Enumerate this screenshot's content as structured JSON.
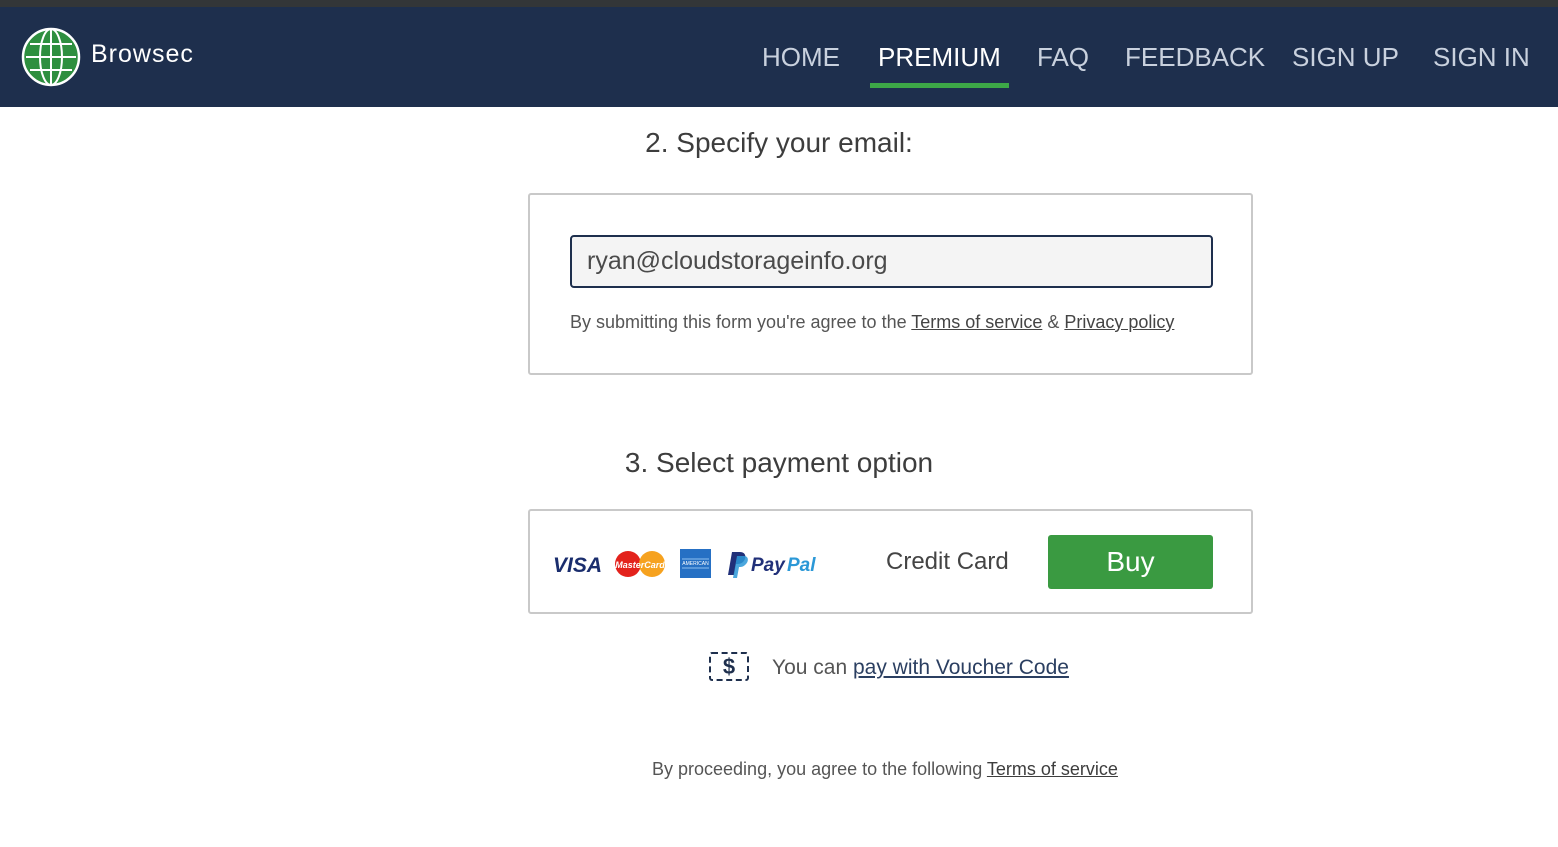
{
  "brand": {
    "name": "Browsec"
  },
  "nav": {
    "items": [
      {
        "label": "HOME"
      },
      {
        "label": "PREMIUM",
        "active": true
      },
      {
        "label": "FAQ"
      },
      {
        "label": "FEEDBACK"
      },
      {
        "label": "SIGN UP"
      },
      {
        "label": "SIGN IN"
      }
    ]
  },
  "email_section": {
    "heading": "2. Specify your email:",
    "email_value": "ryan@cloudstorageinfo.org",
    "agree_text": "By submitting this form you're agree to the",
    "terms_label": "Terms of service",
    "amp": "&",
    "privacy_label": "Privacy policy"
  },
  "payment_section": {
    "heading": "3. Select payment option",
    "card_logos": [
      "visa-logo",
      "mastercard-logo",
      "amex-logo",
      "paypal-logo"
    ],
    "method_label": "Credit Card",
    "buy_label": "Buy"
  },
  "voucher": {
    "icon": "dollar-voucher-icon",
    "icon_glyph": "$",
    "prefix": "You can",
    "link_label": "pay with Voucher Code"
  },
  "footer_agree": {
    "text": "By proceeding, you agree to the following",
    "terms_label": "Terms of service"
  },
  "colors": {
    "navbar_bg": "#1e2f4d",
    "accent_green": "#3a9a41",
    "active_underline": "#3da847"
  }
}
